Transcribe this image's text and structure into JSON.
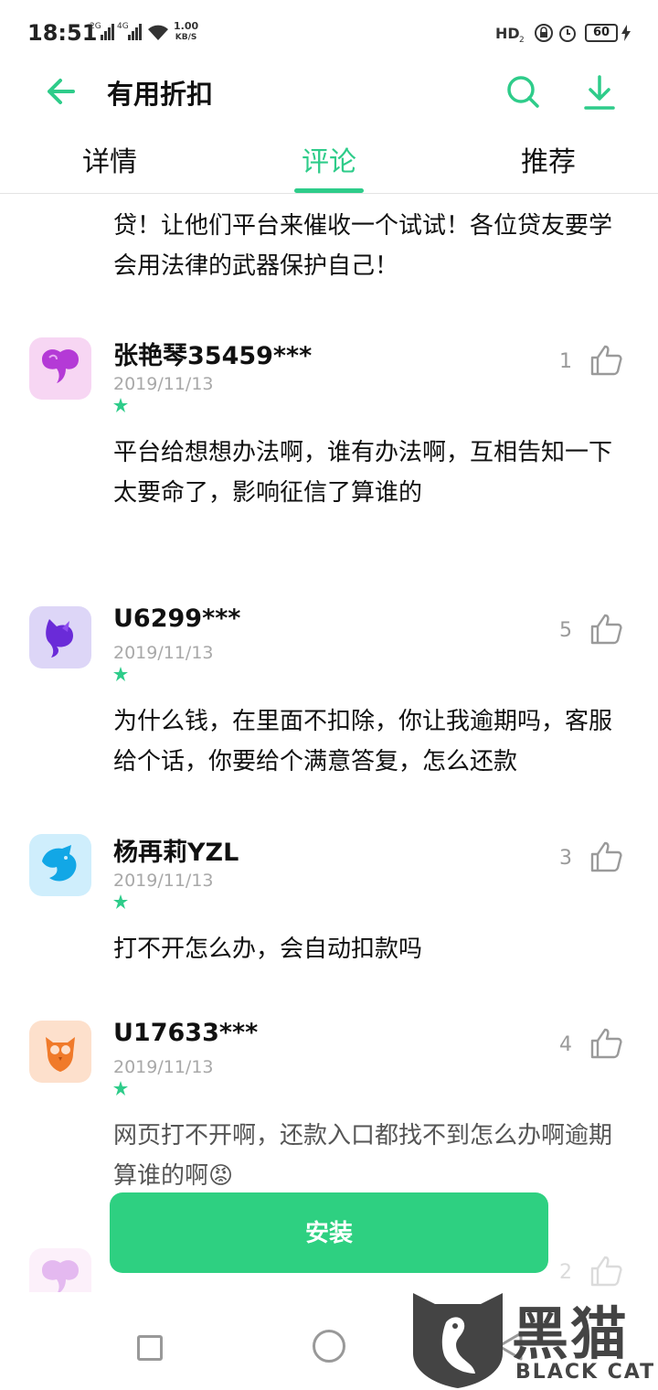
{
  "status_bar": {
    "time": "18:51",
    "sim1_label": "2G",
    "sim2_label": "4G",
    "net_speed_value": "1.00",
    "net_speed_unit": "KB/S",
    "battery": "60"
  },
  "app_bar": {
    "title": "有用折扣",
    "back_icon": "arrow-left-icon",
    "search_icon": "search-icon",
    "download_icon": "download-icon"
  },
  "tabs": [
    {
      "label": "详情",
      "active": false
    },
    {
      "label": "评论",
      "active": true
    },
    {
      "label": "推荐",
      "active": false
    }
  ],
  "partial_review_text": "贷！让他们平台来催收一个试试！各位贷友要学会用法律的武器保护自己！",
  "reviews": [
    {
      "name": "张艳琴35459***",
      "date": "2019/11/13",
      "likes": "1",
      "text": "平台给想想办法啊，谁有办法啊，互相告知一下\n太要命了，影响征信了算谁的",
      "rating": 1
    },
    {
      "name": "U6299***",
      "date": "2019/11/13",
      "likes": "5",
      "text": "为什么钱，在里面不扣除，你让我逾期吗，客服给个话，你要给个满意答复，怎么还款",
      "rating": 1
    },
    {
      "name": "杨再莉YZL",
      "date": "2019/11/13",
      "likes": "3",
      "text": "打不开怎么办，会自动扣款吗",
      "rating": 1
    },
    {
      "name": "U17633***",
      "date": "2019/11/13",
      "likes": "4",
      "text": "网页打不开啊，还款入口都找不到怎么办啊逾期算谁的啊😡",
      "rating": 1
    },
    {
      "name": "",
      "date": "",
      "likes": "2",
      "text": "",
      "rating": 0
    }
  ],
  "install_label": "安装",
  "watermark": {
    "cn": "黑猫",
    "en": "BLACK CAT"
  },
  "colors": {
    "accent": "#2ecc8a",
    "install": "#2ed081"
  }
}
